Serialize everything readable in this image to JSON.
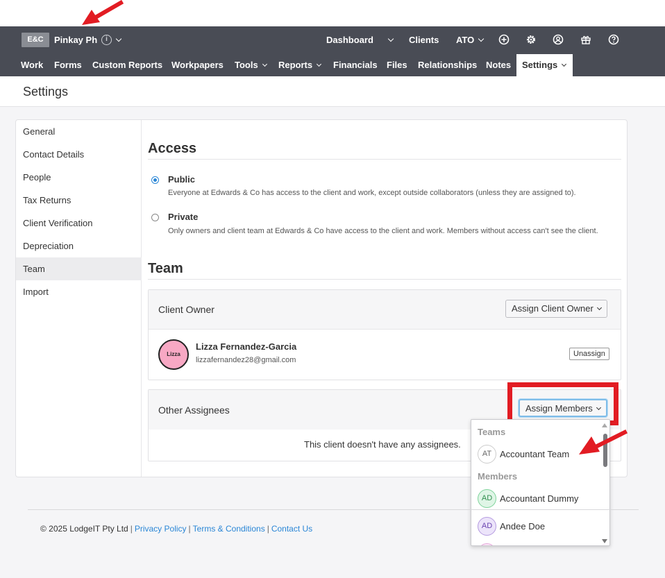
{
  "header": {
    "logo": "E&C",
    "client_name": "Pinkay Ph",
    "info_glyph": "i",
    "links": {
      "dashboard": "Dashboard",
      "clients": "Clients",
      "ato": "ATO"
    },
    "icons": [
      "plus-circle-icon",
      "gear-icon",
      "user-circle-icon",
      "gift-icon",
      "help-icon"
    ]
  },
  "nav": {
    "items": [
      "Work",
      "Forms",
      "Custom Reports",
      "Workpapers",
      "Tools",
      "Reports",
      "Financials",
      "Files",
      "Relationships",
      "Notes",
      "Settings"
    ],
    "active": "Settings"
  },
  "page": {
    "title": "Settings"
  },
  "sidebar": {
    "items": [
      "General",
      "Contact Details",
      "People",
      "Tax Returns",
      "Client Verification",
      "Depreciation",
      "Team",
      "Import"
    ],
    "active": "Team"
  },
  "access": {
    "title": "Access",
    "options": [
      {
        "label": "Public",
        "desc": "Everyone at Edwards & Co has access to the client and work, except outside collaborators (unless they are assigned to).",
        "selected": true
      },
      {
        "label": "Private",
        "desc": "Only owners and client team at Edwards & Co have access to the client and work. Members without access can't see the client.",
        "selected": false
      }
    ]
  },
  "team": {
    "title": "Team",
    "client_owner": {
      "label": "Client Owner",
      "assign_button": "Assign Client Owner",
      "owner": {
        "avatar_text": "Lizza",
        "name": "Lizza Fernandez-Garcia",
        "email": "lizzafernandez28@gmail.com",
        "unassign": "Unassign"
      }
    },
    "other_assignees": {
      "label": "Other Assignees",
      "assign_button": "Assign Members",
      "empty": "This client doesn't have any assignees."
    }
  },
  "dropdown": {
    "groups": [
      {
        "label": "Teams",
        "items": [
          {
            "initials": "AT",
            "name": "Accountant Team"
          }
        ]
      },
      {
        "label": "Members",
        "items": [
          {
            "initials": "AD",
            "name": "Accountant Dummy"
          },
          {
            "initials": "AD",
            "name": "Andee Doe"
          }
        ]
      }
    ]
  },
  "footer": {
    "copyright": "© 2025 LodgeIT Pty Ltd",
    "links": [
      "Privacy Policy",
      "Terms & Conditions",
      "Contact Us"
    ]
  },
  "colors": {
    "nav_bg": "#494c55",
    "link": "#2a86d6",
    "highlight": "#e21c23",
    "avatar_pink": "#f8a8c4"
  }
}
